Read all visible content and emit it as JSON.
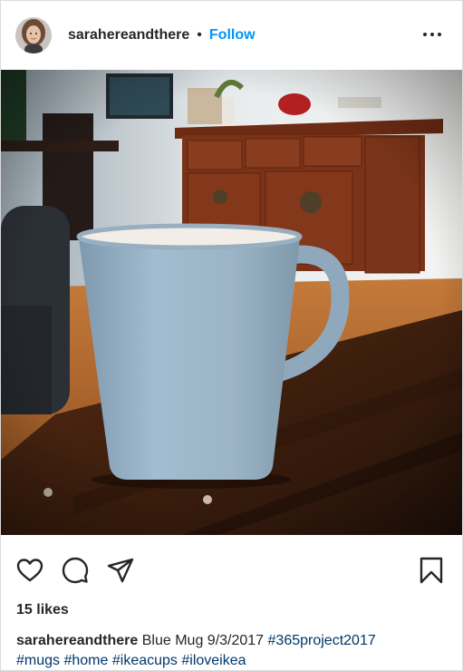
{
  "header": {
    "username": "sarahereandthere",
    "separator": "•",
    "follow_label": "Follow"
  },
  "photo": {
    "subject": "light blue ceramic mug on a dark wooden table"
  },
  "actions": {
    "like_icon": "heart-icon",
    "comment_icon": "comment-icon",
    "share_icon": "paper-plane-icon",
    "save_icon": "bookmark-icon"
  },
  "likes_text": "15 likes",
  "caption": {
    "username": "sarahereandthere",
    "text": "Blue Mug 9/3/2017",
    "hashtags": [
      "#365project2017",
      "#mugs",
      "#home",
      "#ikeacups",
      "#iloveikea"
    ]
  },
  "colors": {
    "follow_blue": "#0095f6",
    "hashtag_blue": "#00376b",
    "text": "#262626",
    "border": "#dbdbdb"
  }
}
